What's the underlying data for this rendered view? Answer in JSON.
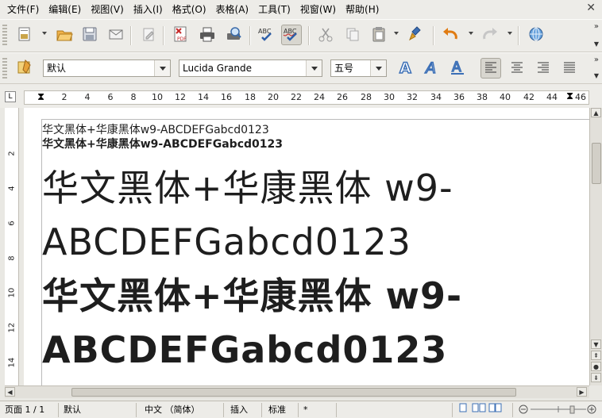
{
  "menubar": {
    "items": [
      "文件(F)",
      "编辑(E)",
      "视图(V)",
      "插入(I)",
      "格式(O)",
      "表格(A)",
      "工具(T)",
      "视窗(W)",
      "帮助(H)"
    ]
  },
  "formatting": {
    "style": "默认",
    "font": "Lucida Grande",
    "size": "五号"
  },
  "ruler": {
    "corner": "L",
    "ticks": [
      "2",
      "4",
      "6",
      "8",
      "10",
      "12",
      "14",
      "16",
      "18",
      "20",
      "22",
      "24",
      "26",
      "28",
      "30",
      "32",
      "34",
      "36",
      "38",
      "40",
      "42",
      "44",
      "46"
    ],
    "vticks": [
      "2",
      "4",
      "6",
      "8",
      "10",
      "12",
      "14"
    ]
  },
  "document": {
    "lines": [
      "华文黑体+华康黑体w9-ABCDEFGabcd0123",
      "华文黑体+华康黑体w9-ABCDEFGabcd0123",
      "华文黑体+华康黑体 w9-",
      "ABCDEFGabcd0123",
      "华文黑体+华康黑体 w9-",
      "ABCDEFGabcd0123"
    ]
  },
  "statusbar": {
    "page": "页面 1 / 1",
    "style": "默认",
    "language": "中文 （简体）",
    "insert_mode": "插入",
    "selection_mode": "标准",
    "modified": "*"
  },
  "colors": {
    "accent": "#3b6fb6",
    "text": "#1e1e1e"
  }
}
